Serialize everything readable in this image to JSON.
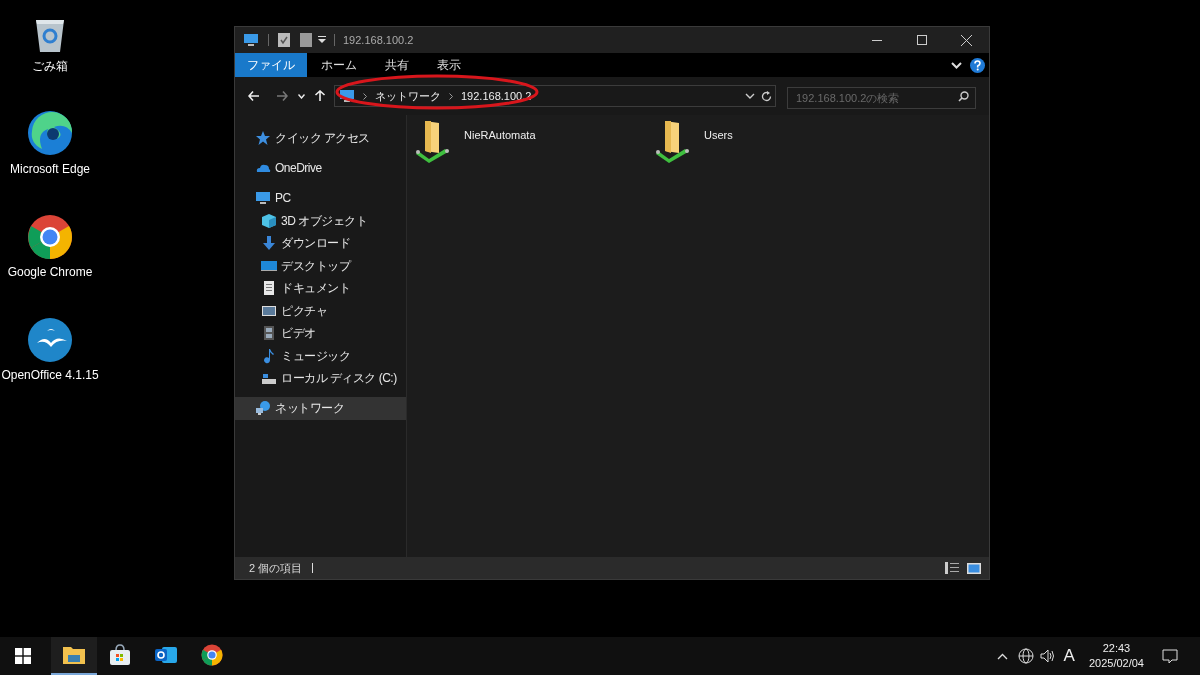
{
  "desktop_icons": [
    {
      "label": "ごみ箱",
      "kind": "recycle"
    },
    {
      "label": "Microsoft Edge",
      "kind": "edge"
    },
    {
      "label": "Google Chrome",
      "kind": "chrome"
    },
    {
      "label": "OpenOffice 4.1.15",
      "kind": "openoffice"
    }
  ],
  "window": {
    "title": "192.168.100.2",
    "ribbon_tabs": [
      {
        "label": "ファイル",
        "selected": true
      },
      {
        "label": "ホーム",
        "selected": false
      },
      {
        "label": "共有",
        "selected": false
      },
      {
        "label": "表示",
        "selected": false
      }
    ],
    "address": {
      "breadcrumb": [
        "ネットワーク",
        "192.168.100.2"
      ]
    },
    "search": {
      "placeholder": "192.168.100.2の検索"
    },
    "sidebar": {
      "items": [
        {
          "label": "クイック アクセス",
          "kind": "star",
          "selected": false
        },
        {
          "label": "OneDrive",
          "kind": "cloud",
          "selected": false
        },
        {
          "label": "PC",
          "kind": "pc",
          "selected": false,
          "children": [
            {
              "label": "3D オブジェクト",
              "kind": "cube",
              "selected": false
            },
            {
              "label": "ダウンロード",
              "kind": "download",
              "selected": false
            },
            {
              "label": "デスクトップ",
              "kind": "desktop",
              "selected": false
            },
            {
              "label": "ドキュメント",
              "kind": "document",
              "selected": false
            },
            {
              "label": "ピクチャ",
              "kind": "picture",
              "selected": false
            },
            {
              "label": "ビデオ",
              "kind": "video",
              "selected": false
            },
            {
              "label": "ミュージック",
              "kind": "music",
              "selected": false
            },
            {
              "label": "ローカル ディスク (C:)",
              "kind": "drive",
              "selected": false
            }
          ]
        },
        {
          "label": "ネットワーク",
          "kind": "network",
          "selected": true
        }
      ]
    },
    "items": [
      {
        "name": "NieRAutomata"
      },
      {
        "name": "Users"
      }
    ],
    "status_bar": {
      "count": "2 個の項目"
    }
  },
  "taskbar": {
    "apps": [
      {
        "kind": "explorer",
        "active": true
      },
      {
        "kind": "store",
        "active": false
      },
      {
        "kind": "outlook",
        "active": false
      },
      {
        "kind": "chrome",
        "active": false
      }
    ],
    "ime": "A",
    "clock": {
      "time": "22:43",
      "date": "2025/02/04"
    }
  }
}
